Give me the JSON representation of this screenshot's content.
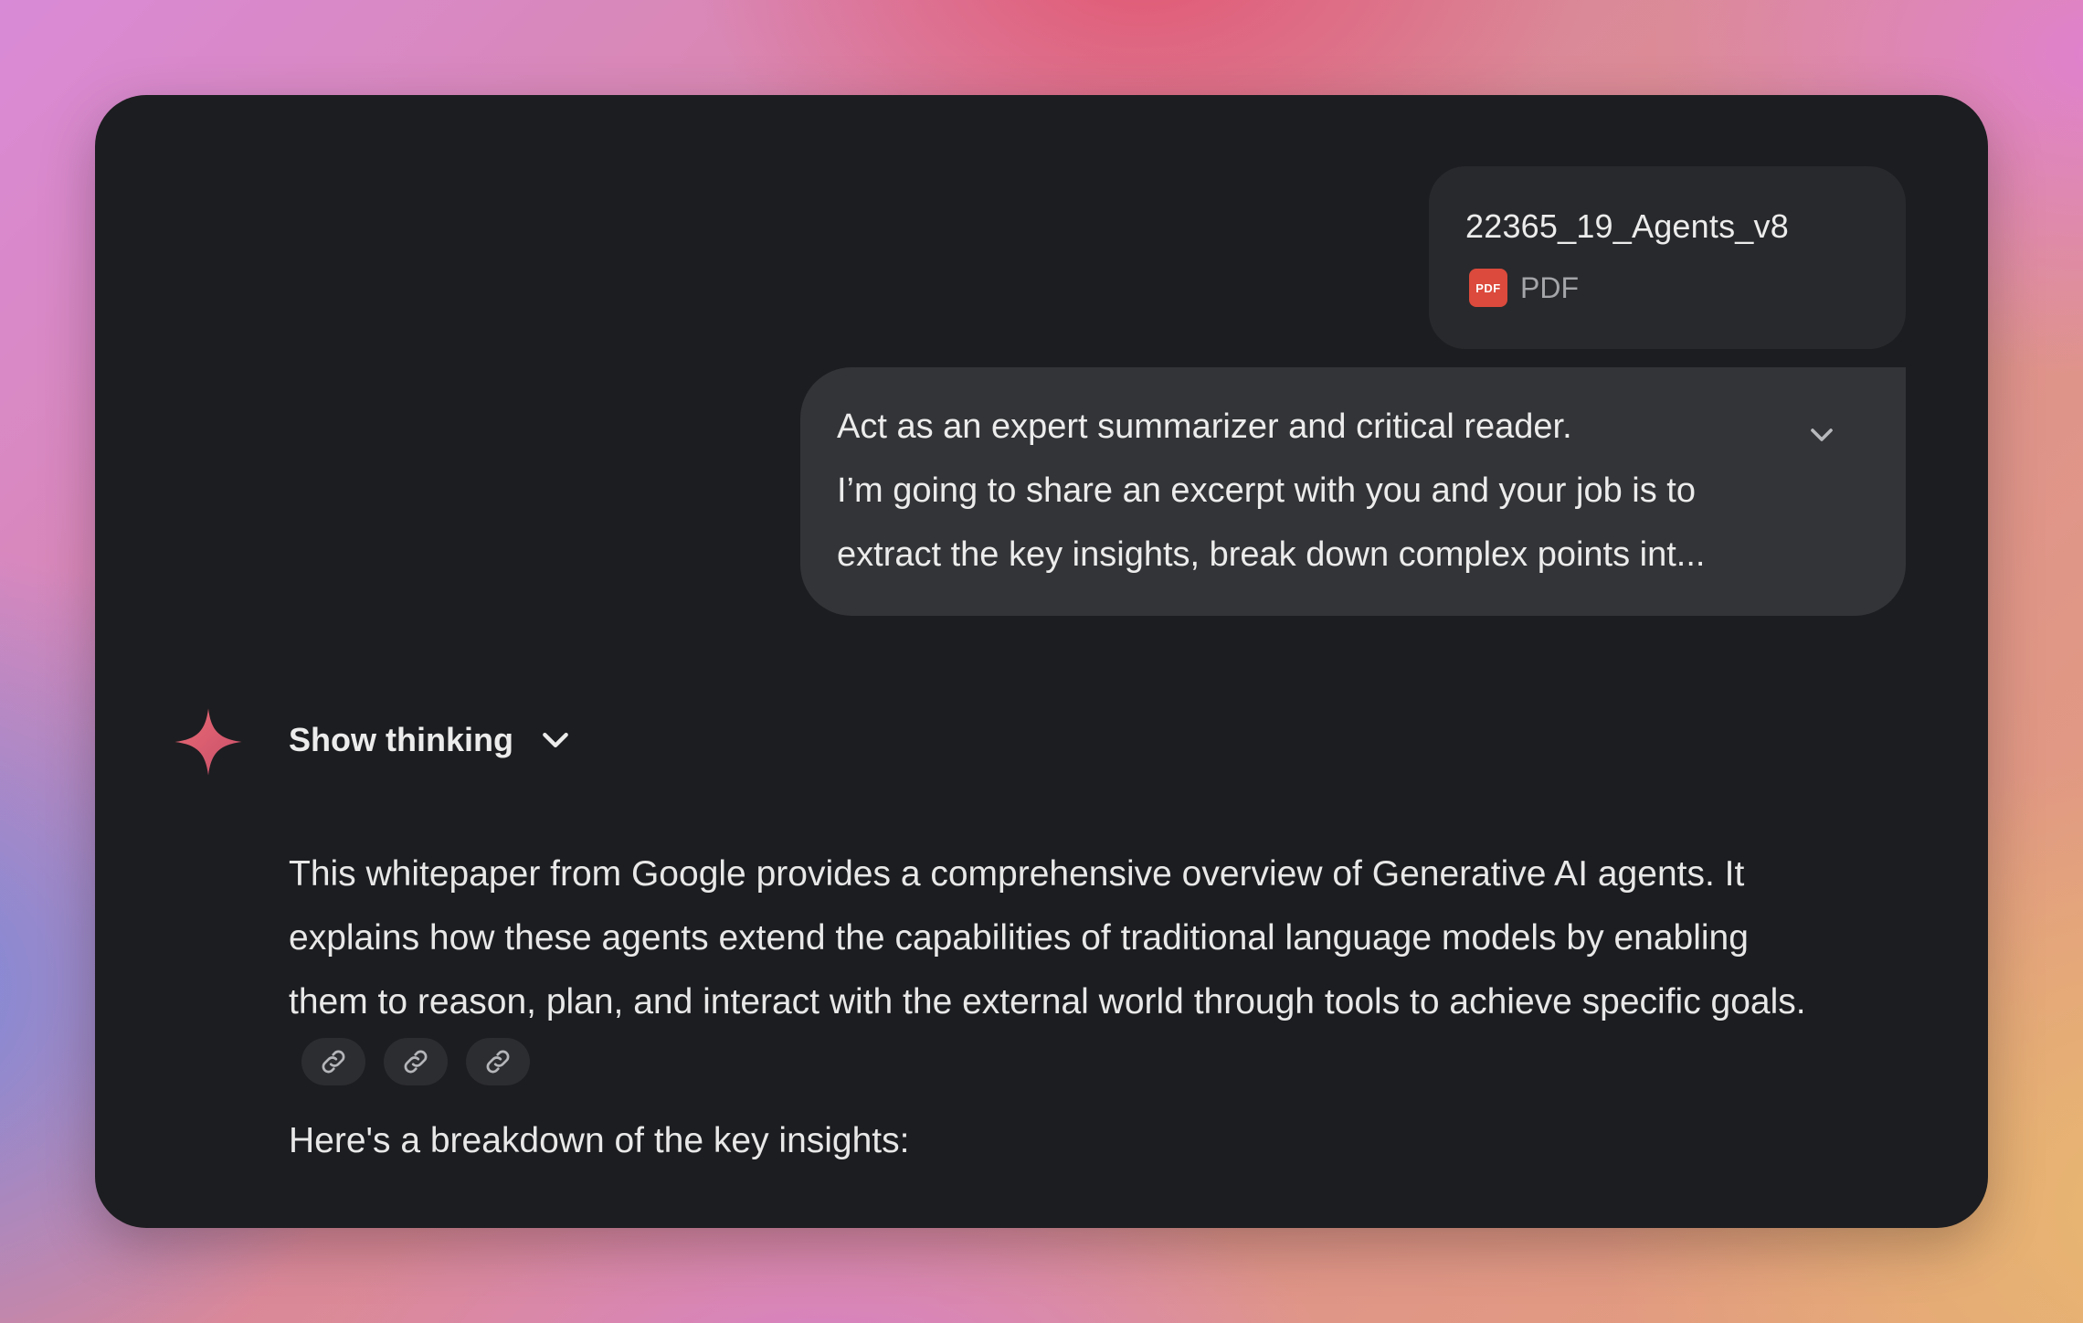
{
  "attachment": {
    "file_name": "22365_19_Agents_v8",
    "file_type": "PDF",
    "icon": "pdf-icon",
    "icon_label": "PDF",
    "icon_color": "#db4a3c"
  },
  "user_message": {
    "lines": [
      "Act as an expert summarizer and critical reader.",
      "I’m going to share an excerpt with you and your job is to",
      "extract the key insights, break down complex points int..."
    ],
    "expand_icon": "chevron-down-icon"
  },
  "assistant": {
    "avatar_icon": "gemini-spark-icon",
    "show_thinking_label": "Show thinking",
    "paragraph_lines": [
      "This whitepaper from Google provides a comprehensive overview of Generative AI agents. It",
      "explains how these agents extend the capabilities of traditional language models by enabling",
      "them to reason, plan, and interact with the external world through tools to achieve specific goals."
    ],
    "source_chip_icons": [
      "link-icon",
      "link-icon",
      "link-icon"
    ],
    "breakdown_intro": "Here's a breakdown of the key insights:"
  },
  "colors": {
    "card_background": "#1c1d20",
    "bubble_background": "#333437",
    "chip_background": "#28292c",
    "spark_color": "#e0636f",
    "text_primary": "#ececec"
  }
}
